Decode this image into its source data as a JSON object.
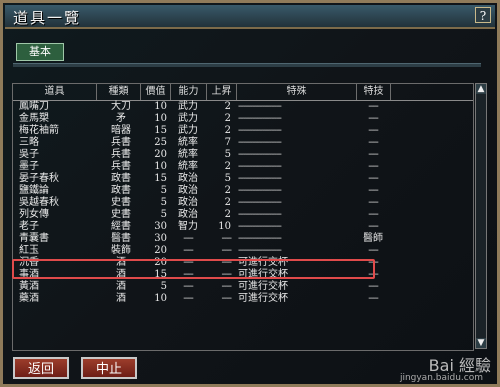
{
  "window": {
    "title": "道具一覽",
    "help": "?"
  },
  "tabs": {
    "basic": "基本"
  },
  "table": {
    "headers": [
      "道具",
      "種類",
      "價值",
      "能力",
      "上昇",
      "特殊",
      "特技"
    ],
    "rows": [
      [
        "鳳嘴刀",
        "大刀",
        "10",
        "武力",
        "2",
        "------------------",
        "----"
      ],
      [
        "金馬槊",
        "矛",
        "10",
        "武力",
        "2",
        "------------------",
        "----"
      ],
      [
        "梅花袖箭",
        "暗器",
        "15",
        "武力",
        "2",
        "------------------",
        "----"
      ],
      [
        "三略",
        "兵書",
        "25",
        "統率",
        "7",
        "------------------",
        "----"
      ],
      [
        "吳子",
        "兵書",
        "20",
        "統率",
        "5",
        "------------------",
        "----"
      ],
      [
        "墨子",
        "兵書",
        "10",
        "統率",
        "2",
        "------------------",
        "----"
      ],
      [
        "晏子春秋",
        "政書",
        "15",
        "政治",
        "5",
        "------------------",
        "----"
      ],
      [
        "鹽鐵論",
        "政書",
        "5",
        "政治",
        "2",
        "------------------",
        "----"
      ],
      [
        "吳越春秋",
        "史書",
        "5",
        "政治",
        "2",
        "------------------",
        "----"
      ],
      [
        "列女傳",
        "史書",
        "5",
        "政治",
        "2",
        "------------------",
        "----"
      ],
      [
        "老子",
        "經書",
        "30",
        "智力",
        "10",
        "------------------",
        "----"
      ],
      [
        "青囊書",
        "醫書",
        "30",
        "----",
        "----",
        "------------------",
        "醫師"
      ],
      [
        "紅玉",
        "裝飾",
        "20",
        "----",
        "----",
        "------------------",
        "----"
      ],
      [
        "沉香",
        "酒",
        "20",
        "----",
        "----",
        "可進行交杯",
        "----"
      ],
      [
        "事酒",
        "酒",
        "15",
        "----",
        "----",
        "可進行交杯",
        "----"
      ],
      [
        "黃酒",
        "酒",
        "5",
        "----",
        "----",
        "可進行交杯",
        "----"
      ],
      [
        "藥酒",
        "酒",
        "10",
        "----",
        "----",
        "可進行交杯",
        "----"
      ]
    ],
    "selected_row_index": 11
  },
  "buttons": {
    "back": "返回",
    "stop": "中止"
  },
  "watermark": {
    "brand": "Bai 經驗",
    "url": "jingyan.baidu.com"
  },
  "colors": {
    "frame": "#8f7b5a",
    "tab_basic": "#2d5f3e",
    "selection": "#e04b4b",
    "button": "#8a2f22"
  },
  "icons": [
    "help-icon",
    "scroll-up-icon",
    "scroll-down-icon"
  ]
}
